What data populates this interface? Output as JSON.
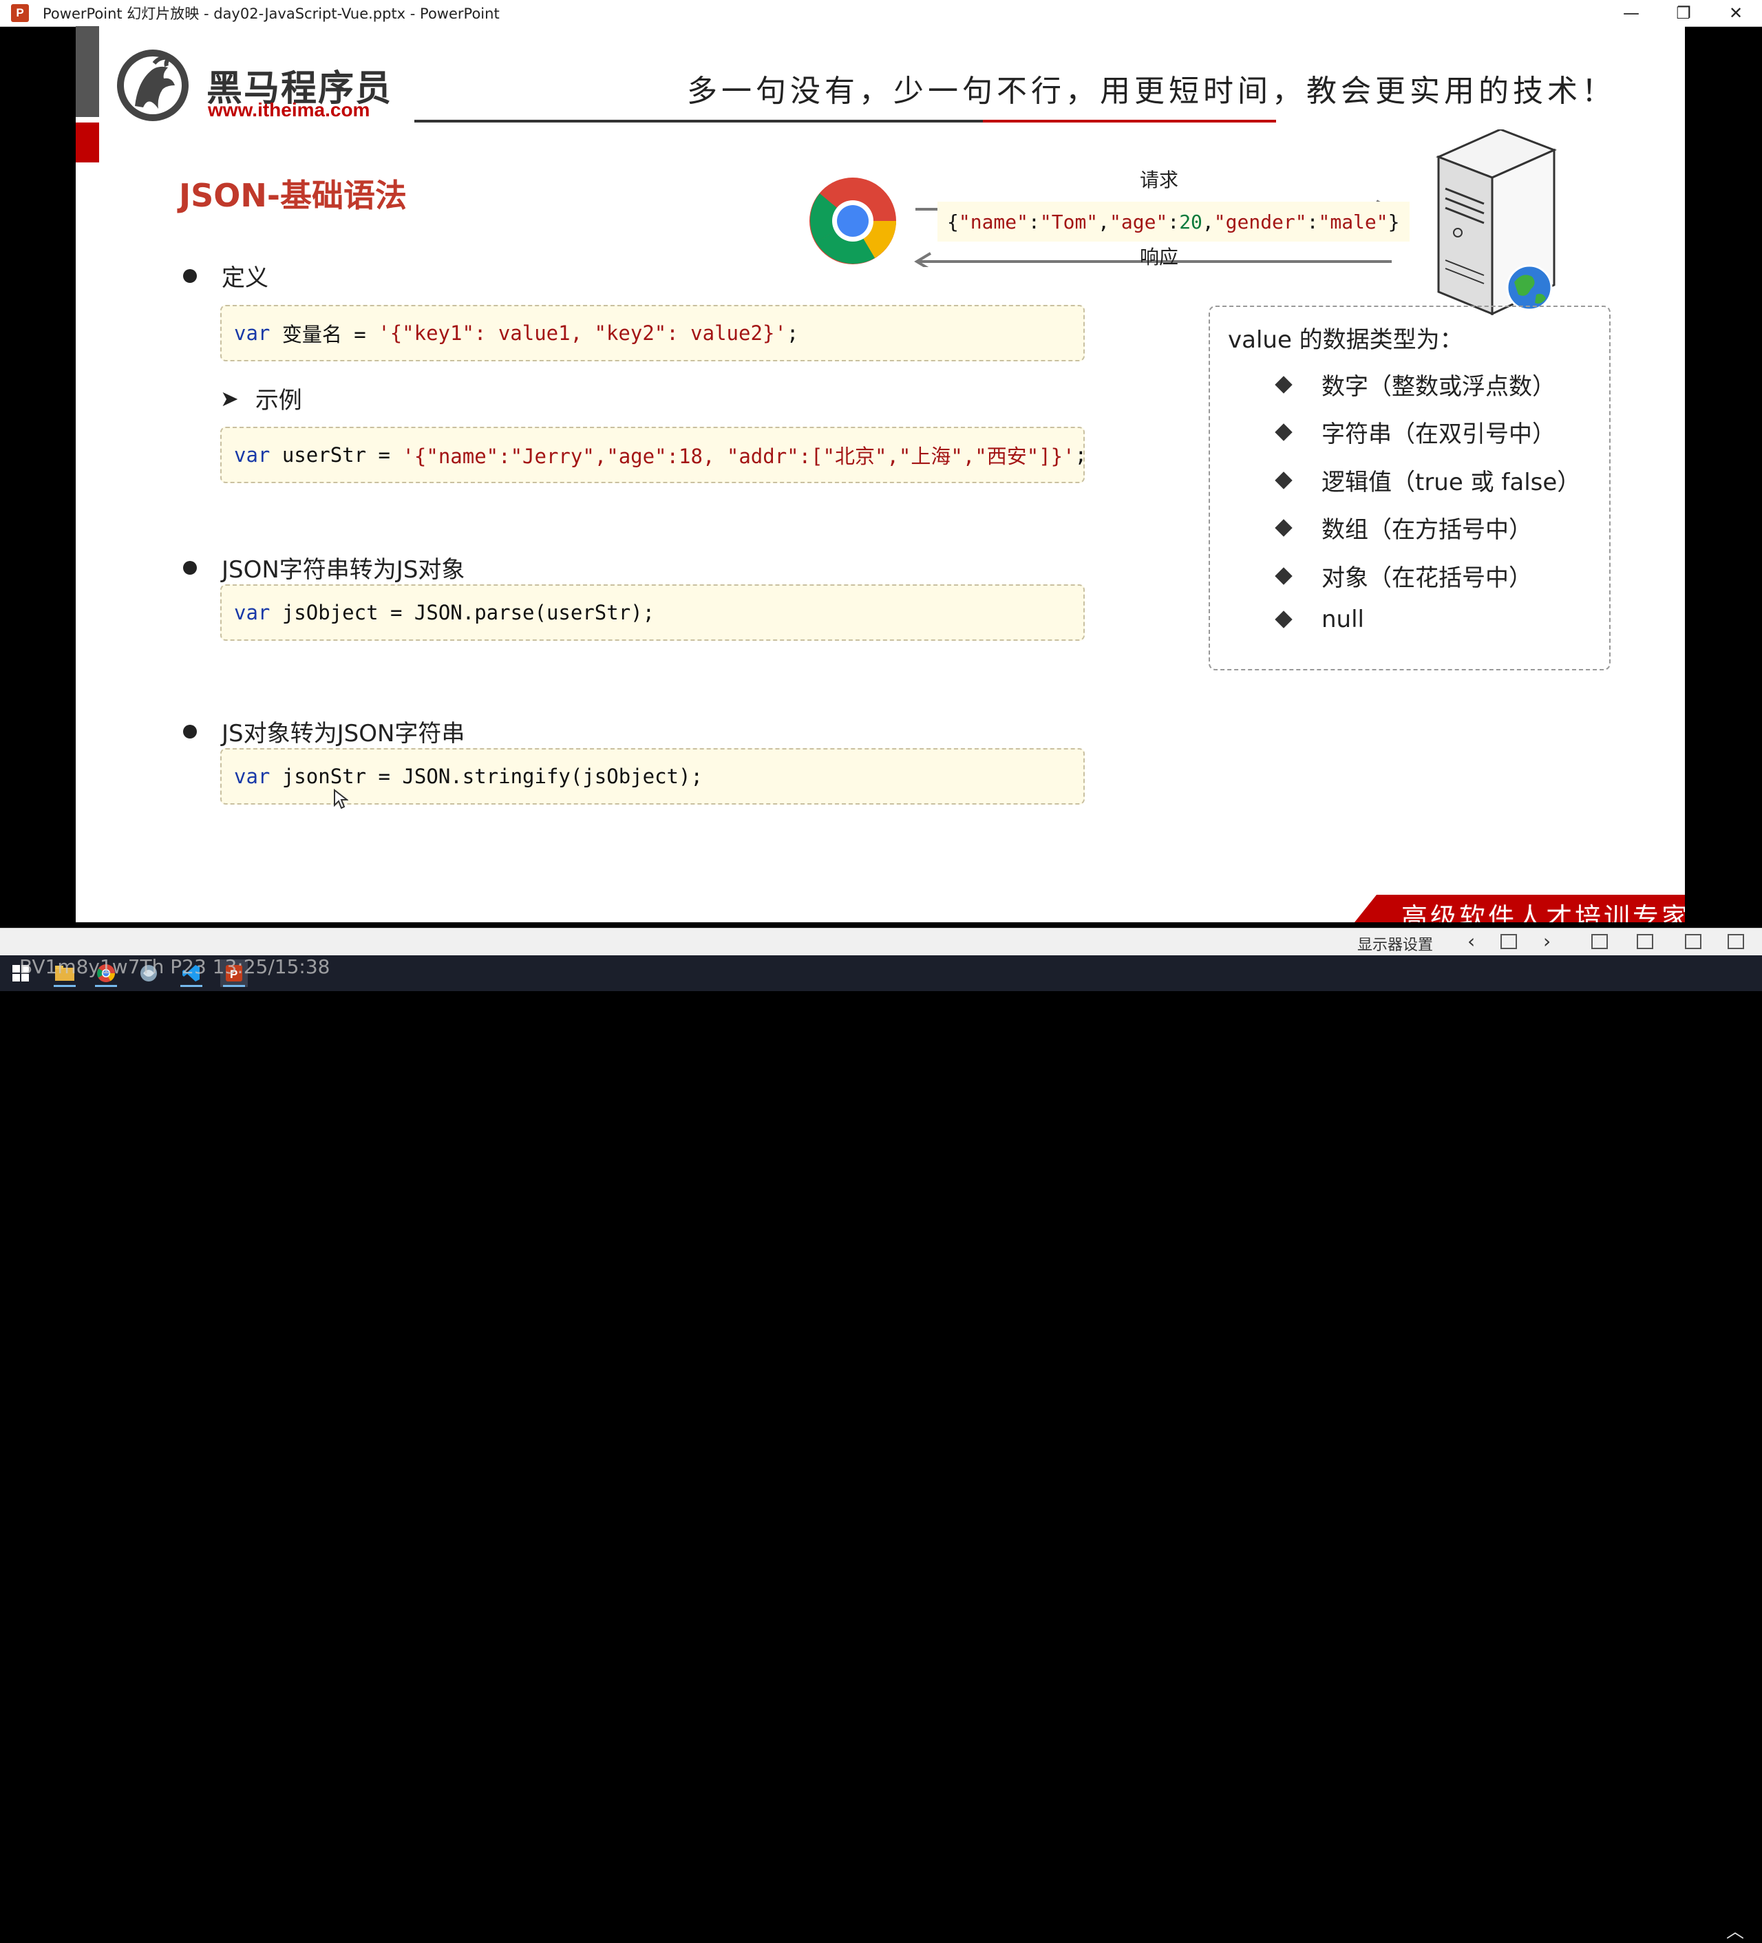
{
  "window": {
    "title": "PowerPoint 幻灯片放映  -  day02-JavaScript-Vue.pptx  -  PowerPoint",
    "app_icon_letter": "P",
    "controls": {
      "minimize": "—",
      "restore": "❐",
      "close": "✕"
    }
  },
  "slide": {
    "logo_text": "黑马程序员",
    "logo_url": "www.itheima.com",
    "slogan": "多一句没有，少一句不行，用更短时间，教会更实用的技术！",
    "heading": "JSON-基础语法",
    "sections": [
      {
        "label": "定义"
      },
      {
        "label": "示例"
      },
      {
        "label": "JSON字符串转为JS对象"
      },
      {
        "label": "JS对象转为JSON字符串"
      }
    ],
    "code": {
      "kw": "var",
      "line1_rest_a": " 变量名 = ",
      "line1_str": "'{\"key1\": value1, \"key2\": value2}'",
      "line1_end": ";",
      "line2_rest_a": " userStr = ",
      "line2_str": "'{\"name\":\"Jerry\",\"age\":18, \"addr\":[\"北京\",\"上海\",\"西安\"]}'",
      "line2_end": ";",
      "line3_rest": " jsObject = JSON.parse(userStr);",
      "line4_rest": " jsonStr = JSON.stringify(jsObject);"
    },
    "diagram": {
      "request_label": "请求",
      "response_label": "响应",
      "json_a": "{",
      "json_name": "\"name\"",
      "json_colon1": ":",
      "json_tom": "\"Tom\"",
      "json_comma1": ",",
      "json_age": "\"age\"",
      "json_colon2": ":",
      "json_20": "20",
      "json_comma2": ",",
      "json_gender": "\"gender\"",
      "json_colon3": ":",
      "json_male": "\"male\"",
      "json_b": "}"
    },
    "types": {
      "title": "value 的数据类型为：",
      "items": [
        "数字（整数或浮点数）",
        "字符串（在双引号中）",
        "逻辑值（true 或 false）",
        "数组（在方括号中）",
        "对象（在花括号中）",
        "null"
      ]
    },
    "corner_banner": "高级软件人才培训专家"
  },
  "presenter_toolbar": {
    "display_settings": "显示器设置",
    "prev": "‹",
    "next": "›"
  },
  "overlay": "BV1m8y1w7Th P23 13:25/15:38",
  "colors": {
    "accent_red": "#c00000",
    "heading_red": "#c0392b",
    "code_bg": "#fffbe6"
  }
}
